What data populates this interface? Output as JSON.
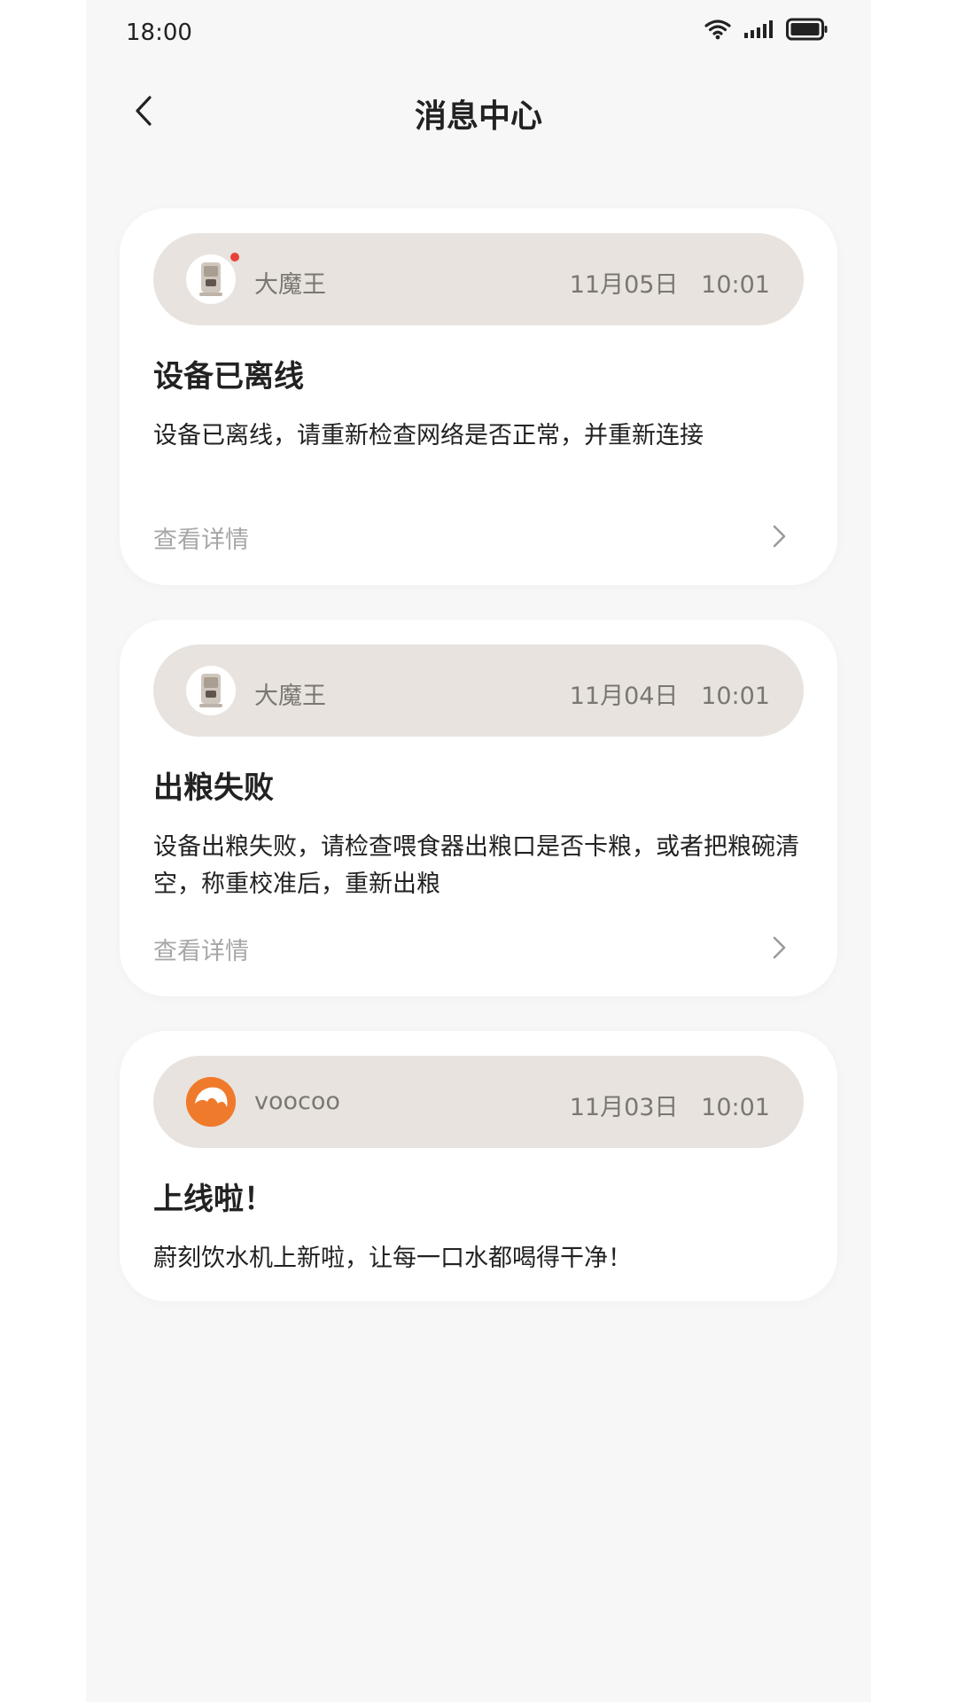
{
  "status_bar": {
    "time": "18:00"
  },
  "header": {
    "title": "消息中心"
  },
  "messages": [
    {
      "sender": "大魔王",
      "time": "11月05日   10:01",
      "title": "设备已离线",
      "body": "设备已离线，请重新检查网络是否正常，并重新连接",
      "detail_label": "查看详情",
      "unread": true,
      "avatar_icon": "feeder-device-icon"
    },
    {
      "sender": "大魔王",
      "time": "11月04日   10:01",
      "title": "出粮失败",
      "body": "设备出粮失败，请检查喂食器出粮口是否卡粮，或者把粮碗清空，称重校准后，重新出粮",
      "detail_label": "查看详情",
      "unread": false,
      "avatar_icon": "feeder-device-icon"
    },
    {
      "sender": "voocoo",
      "time": "11月03日   10:01",
      "title": "上线啦！",
      "body": "蔚刻饮水机上新啦，让每一口水都喝得干净！",
      "avatar_icon": "voocoo-logo-icon"
    }
  ],
  "colors": {
    "background": "#f7f7f7",
    "card": "#ffffff",
    "card_header": "#e8e3de",
    "unread_dot": "#e8413b",
    "brand_orange": "#f07a2c"
  }
}
